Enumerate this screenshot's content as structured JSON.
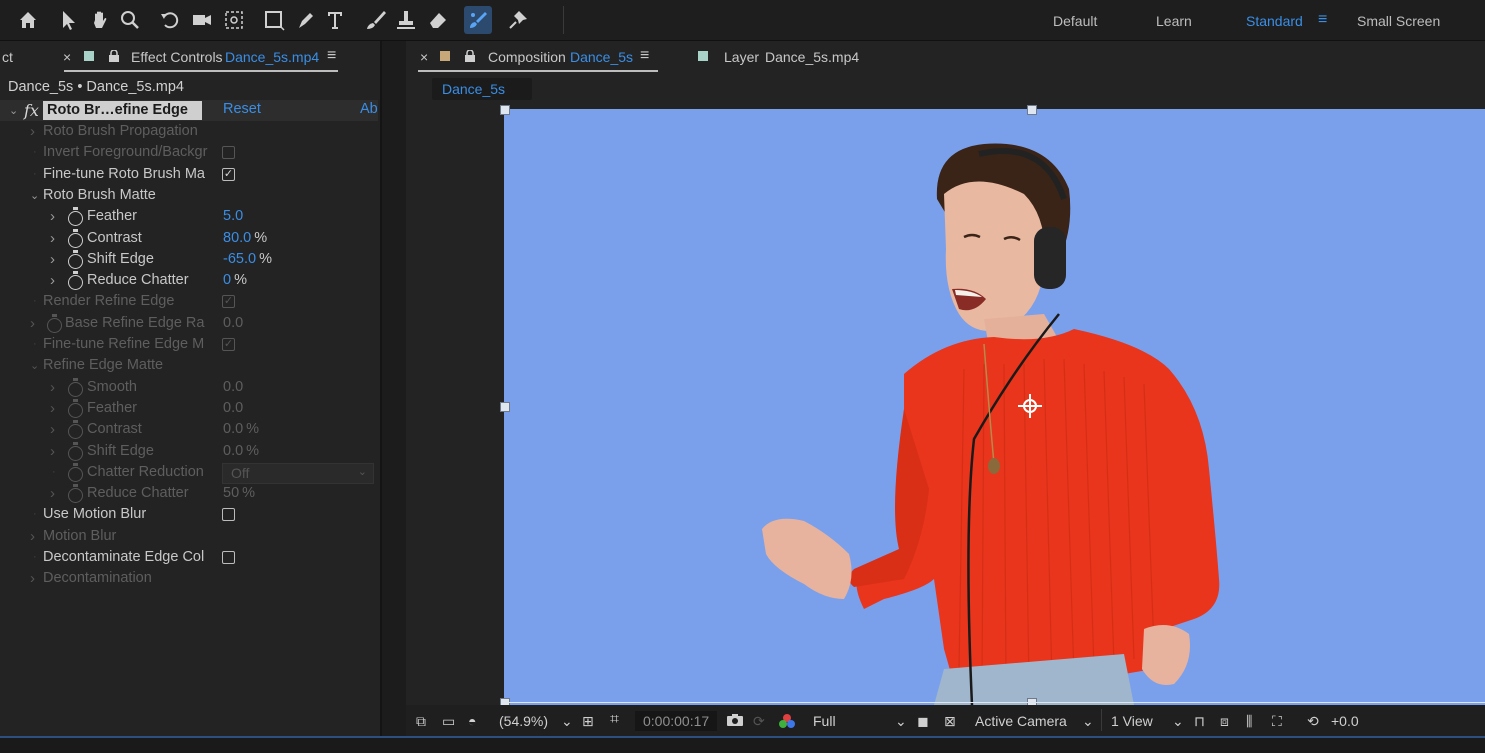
{
  "toolbar": {
    "tools": [
      "home-icon",
      "selection-arrow-icon",
      "hand-icon",
      "zoom-icon",
      "rotate-icon",
      "camera-icon",
      "pan-behind-icon",
      "rectangle-icon",
      "pen-icon",
      "type-icon",
      "brush-icon",
      "clone-stamp-icon",
      "eraser-icon",
      "roto-brush-icon",
      "puppet-pin-icon"
    ],
    "workspaces": [
      {
        "label": "Default",
        "active": false
      },
      {
        "label": "Learn",
        "active": false
      },
      {
        "label": "Standard",
        "active": true
      },
      {
        "label": "Small Screen",
        "active": false
      }
    ],
    "workspace_menu_icon": "≡"
  },
  "effect_controls": {
    "left_tab_fragment": "ct",
    "tab_label": "Effect Controls",
    "tab_file": "Danc e_5s.mp4",
    "tab_file_clean": "Dance_5s.mp4",
    "menu_icon": "≡",
    "expand_icon": "»",
    "breadcrumb": "Dance_5s • Dance_5s.mp4",
    "effect_name": "Roto Br…efine Edge",
    "fx_label": "fx",
    "reset_label": "Reset",
    "about_label": "Abo",
    "properties": [
      {
        "name": "Roto Brush Propagation",
        "indent": 0,
        "chevron": "right",
        "dim": true
      },
      {
        "name": "Invert Foreground/Backgr",
        "indent": 0,
        "checkbox": false,
        "dim": true
      },
      {
        "name": "Fine-tune Roto Brush Ma",
        "indent": 0,
        "checkbox": true,
        "dim": false
      },
      {
        "name": "Roto Brush Matte",
        "indent": 0,
        "chevron": "down",
        "dim": false,
        "group": true
      },
      {
        "name": "Feather",
        "indent": 1,
        "chevron": "right",
        "stopwatch": true,
        "value": "5.0",
        "dim": false
      },
      {
        "name": "Contrast",
        "indent": 1,
        "chevron": "right",
        "stopwatch": true,
        "value": "80.0",
        "unit": "%",
        "dim": false
      },
      {
        "name": "Shift Edge",
        "indent": 1,
        "chevron": "right",
        "stopwatch": true,
        "value": "-65.0",
        "unit": "%",
        "dim": false
      },
      {
        "name": "Reduce Chatter",
        "indent": 1,
        "chevron": "right",
        "stopwatch": true,
        "value": "0",
        "unit": "%",
        "dim": false
      },
      {
        "name": "Render Refine Edge",
        "indent": 0,
        "checkbox": true,
        "dim": true
      },
      {
        "name": "Base Refine Edge Ra",
        "indent": 0,
        "chevron": "right",
        "stopwatch": true,
        "value": "0.0",
        "dim": true
      },
      {
        "name": "Fine-tune Refine Edge M",
        "indent": 0,
        "checkbox": true,
        "dim": true
      },
      {
        "name": "Refine Edge Matte",
        "indent": 0,
        "chevron": "down",
        "dim": true,
        "group": true
      },
      {
        "name": "Smooth",
        "indent": 1,
        "chevron": "right",
        "stopwatch": true,
        "value": "0.0",
        "dim": true
      },
      {
        "name": "Feather",
        "indent": 1,
        "chevron": "right",
        "stopwatch": true,
        "value": "0.0",
        "dim": true
      },
      {
        "name": "Contrast",
        "indent": 1,
        "chevron": "right",
        "stopwatch": true,
        "value": "0.0",
        "unit": "%",
        "dim": true
      },
      {
        "name": "Shift Edge",
        "indent": 1,
        "chevron": "right",
        "stopwatch": true,
        "value": "0.0",
        "unit": "%",
        "dim": true
      },
      {
        "name": "Chatter Reduction",
        "indent": 1,
        "stopwatch": true,
        "dropdown": "Off",
        "dim": true
      },
      {
        "name": "Reduce Chatter",
        "indent": 1,
        "chevron": "right",
        "stopwatch": true,
        "value": "50",
        "unit": "%",
        "dim": true
      },
      {
        "name": "Use Motion Blur",
        "indent": 0,
        "checkbox": false,
        "dim": false
      },
      {
        "name": "Motion Blur",
        "indent": 0,
        "chevron": "right",
        "dim": true
      },
      {
        "name": "Decontaminate Edge Col",
        "indent": 0,
        "checkbox": false,
        "dim": false
      },
      {
        "name": "Decontamination",
        "indent": 0,
        "chevron": "right",
        "dim": true
      }
    ]
  },
  "composition": {
    "close_icon": "×",
    "tab_label": "Composition",
    "tab_comp": "Dance_5s",
    "menu_icon": "≡",
    "layer_tab_label": "Layer",
    "layer_tab_file": "Dance_5s.mp4",
    "subtab": "Dance_5s",
    "background_color": "#7aa0ec",
    "bottom": {
      "zoom": "(54.9%)",
      "timecode": "0:00:00:17",
      "resolution": "Full",
      "camera": "Active Camera",
      "views": "1 View",
      "exposure": "+0.0"
    }
  },
  "colors": {
    "accent": "#3a8ee6",
    "panel": "#232323",
    "sweater": "#e8351c"
  }
}
